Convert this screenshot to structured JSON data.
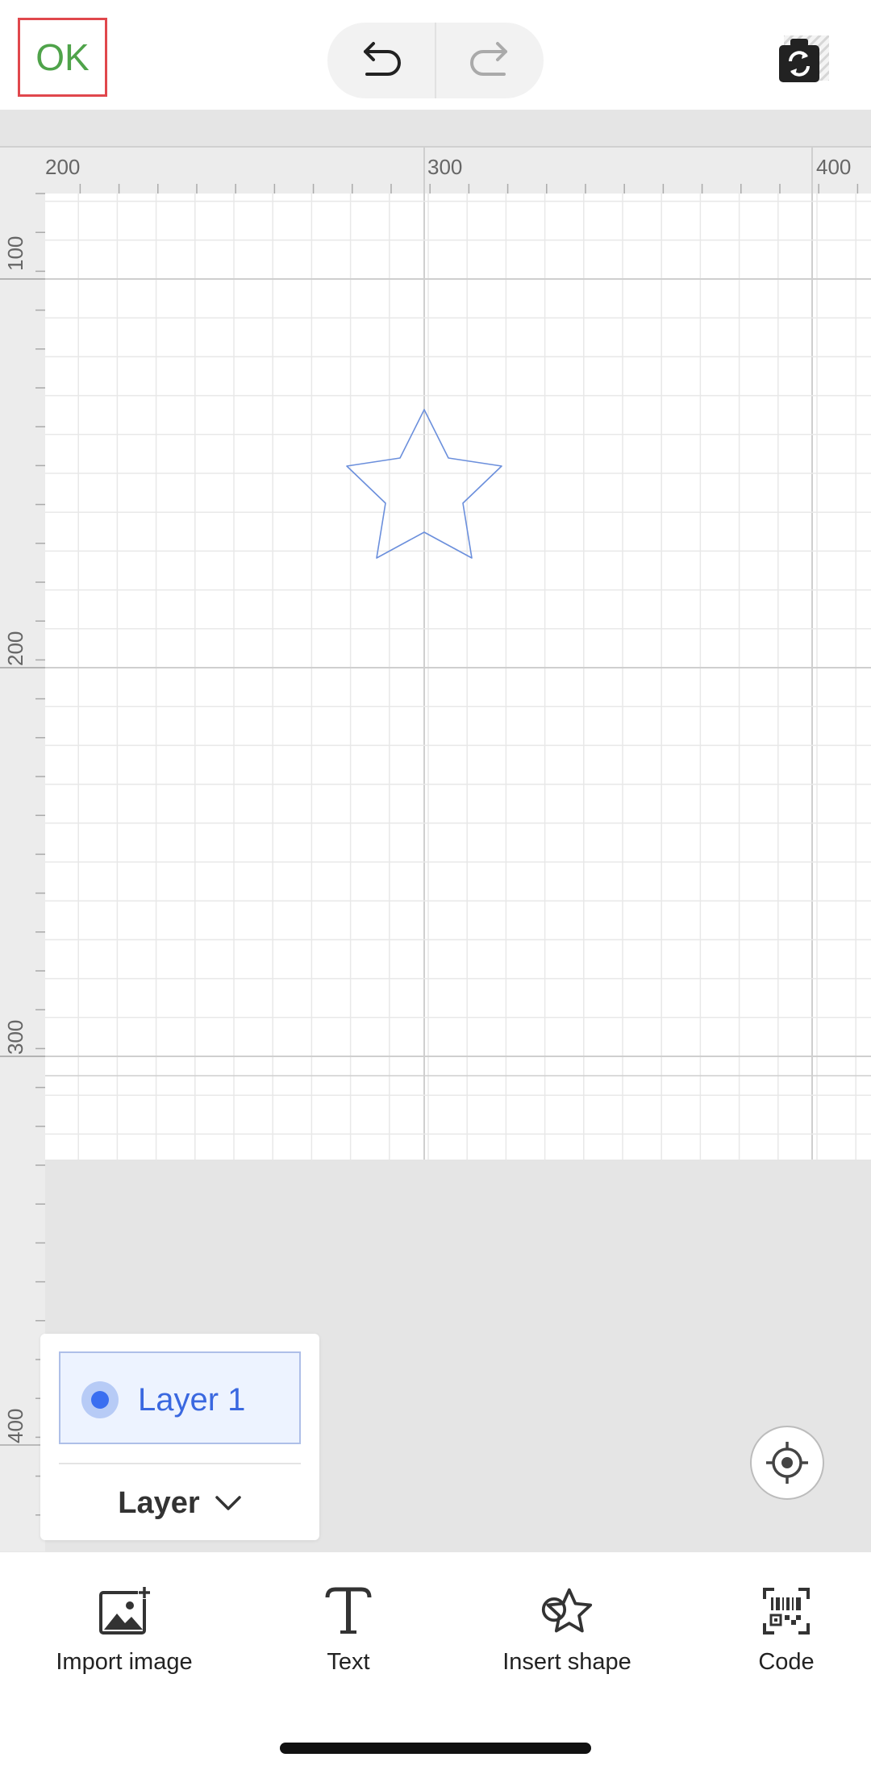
{
  "header": {
    "ok_label": "OK",
    "undo_icon": "undo-icon",
    "redo_icon": "redo-icon",
    "swap_icon": "swap-canvas-icon"
  },
  "ruler": {
    "x_labels": [
      "200",
      "300",
      "400"
    ],
    "y_labels": [
      "100",
      "200",
      "300",
      "400"
    ]
  },
  "canvas": {
    "shape": "star",
    "shape_color": "#6b8fdc"
  },
  "layer_panel": {
    "items": [
      {
        "label": "Layer 1",
        "selected": true
      }
    ],
    "dropdown_label": "Layer"
  },
  "toolbar": {
    "items": [
      {
        "label": "Import image",
        "icon": "import-image-icon"
      },
      {
        "label": "Text",
        "icon": "text-icon"
      },
      {
        "label": "Insert shape",
        "icon": "insert-shape-icon"
      },
      {
        "label": "Code",
        "icon": "code-icon"
      }
    ]
  },
  "colors": {
    "accent": "#3a6ef0",
    "ok_text": "#4fa34a",
    "ok_border": "#e0474c"
  }
}
